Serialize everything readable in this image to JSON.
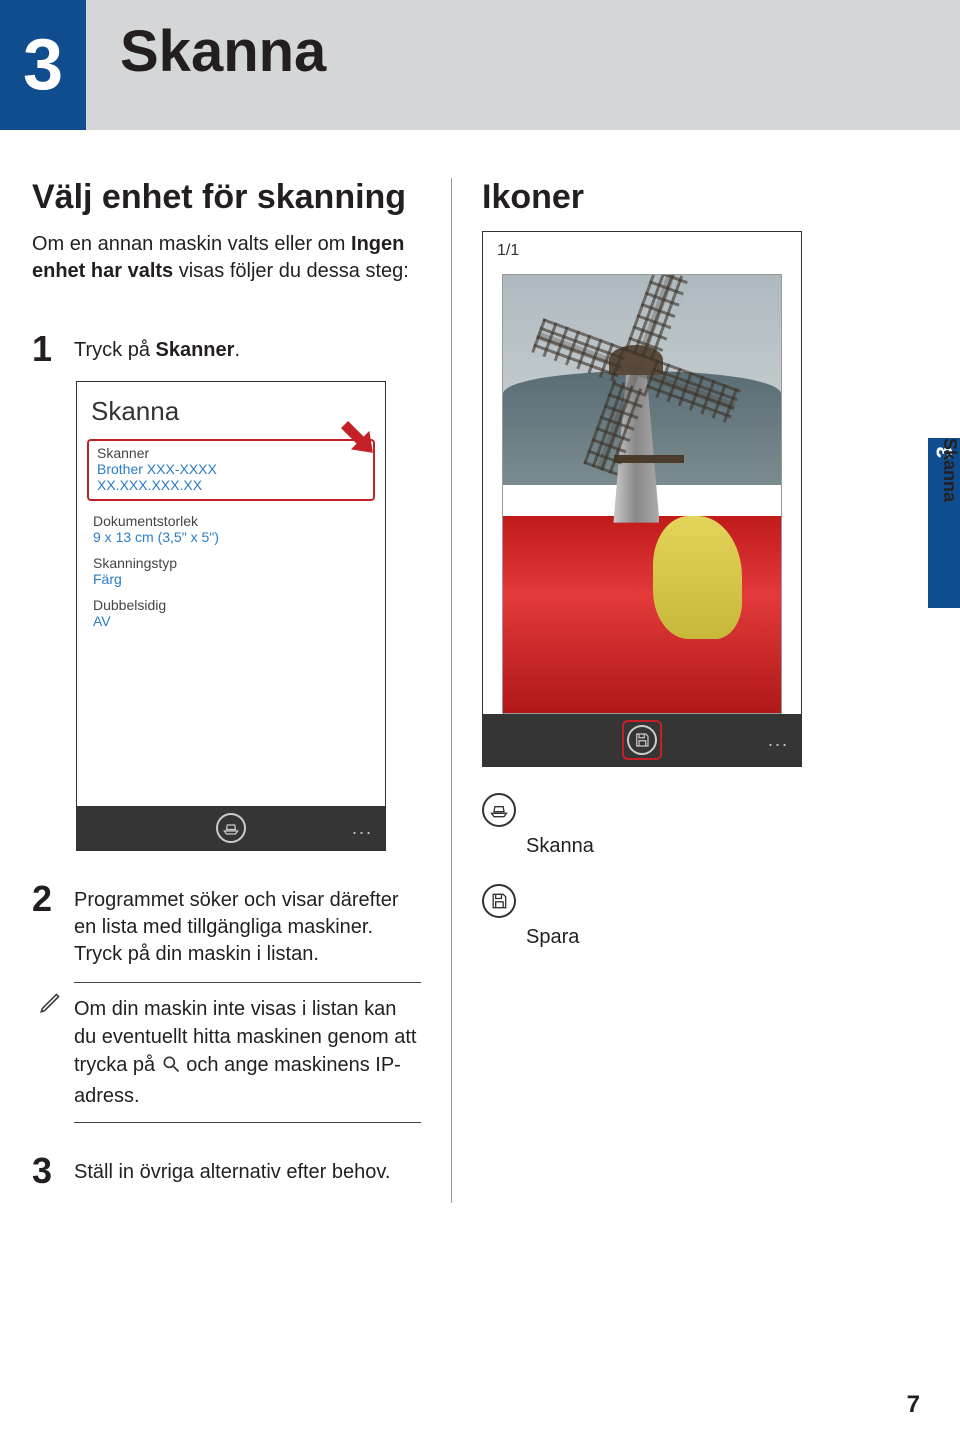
{
  "chapter": {
    "number": "3",
    "title": "Skanna"
  },
  "left": {
    "heading": "Välj enhet för skanning",
    "intro_pre": "Om en annan maskin valts eller om ",
    "intro_bold": "Ingen enhet har valts",
    "intro_post": " visas följer du dessa steg:",
    "step1_pre": "Tryck på ",
    "step1_bold": "Skanner",
    "step1_post": ".",
    "phone1": {
      "title": "Skanna",
      "scanner_label": "Skanner",
      "scanner_name": "Brother XXX-XXXX",
      "scanner_ip": "XX.XXX.XXX.XX",
      "docsize_label": "Dokumentstorlek",
      "docsize_value": "9 x 13 cm (3,5\" x 5\")",
      "scantype_label": "Skanningstyp",
      "scantype_value": "Färg",
      "duplex_label": "Dubbelsidig",
      "duplex_value": "AV",
      "more": "..."
    },
    "step2": "Programmet söker och visar därefter en lista med tillgängliga maskiner. Tryck på din maskin i listan.",
    "note_pre": "Om din maskin inte visas i listan kan du eventuellt hitta maskinen genom att trycka på ",
    "note_post": " och ange maskinens IP-adress.",
    "step3": "Ställ in övriga alternativ efter behov."
  },
  "right": {
    "heading": "Ikoner",
    "pages": "1/1",
    "more": "...",
    "icon_scan_label": "Skanna",
    "icon_save_label": "Spara"
  },
  "side_tab": {
    "num": "3",
    "label": "Skanna"
  },
  "page_number": "7"
}
